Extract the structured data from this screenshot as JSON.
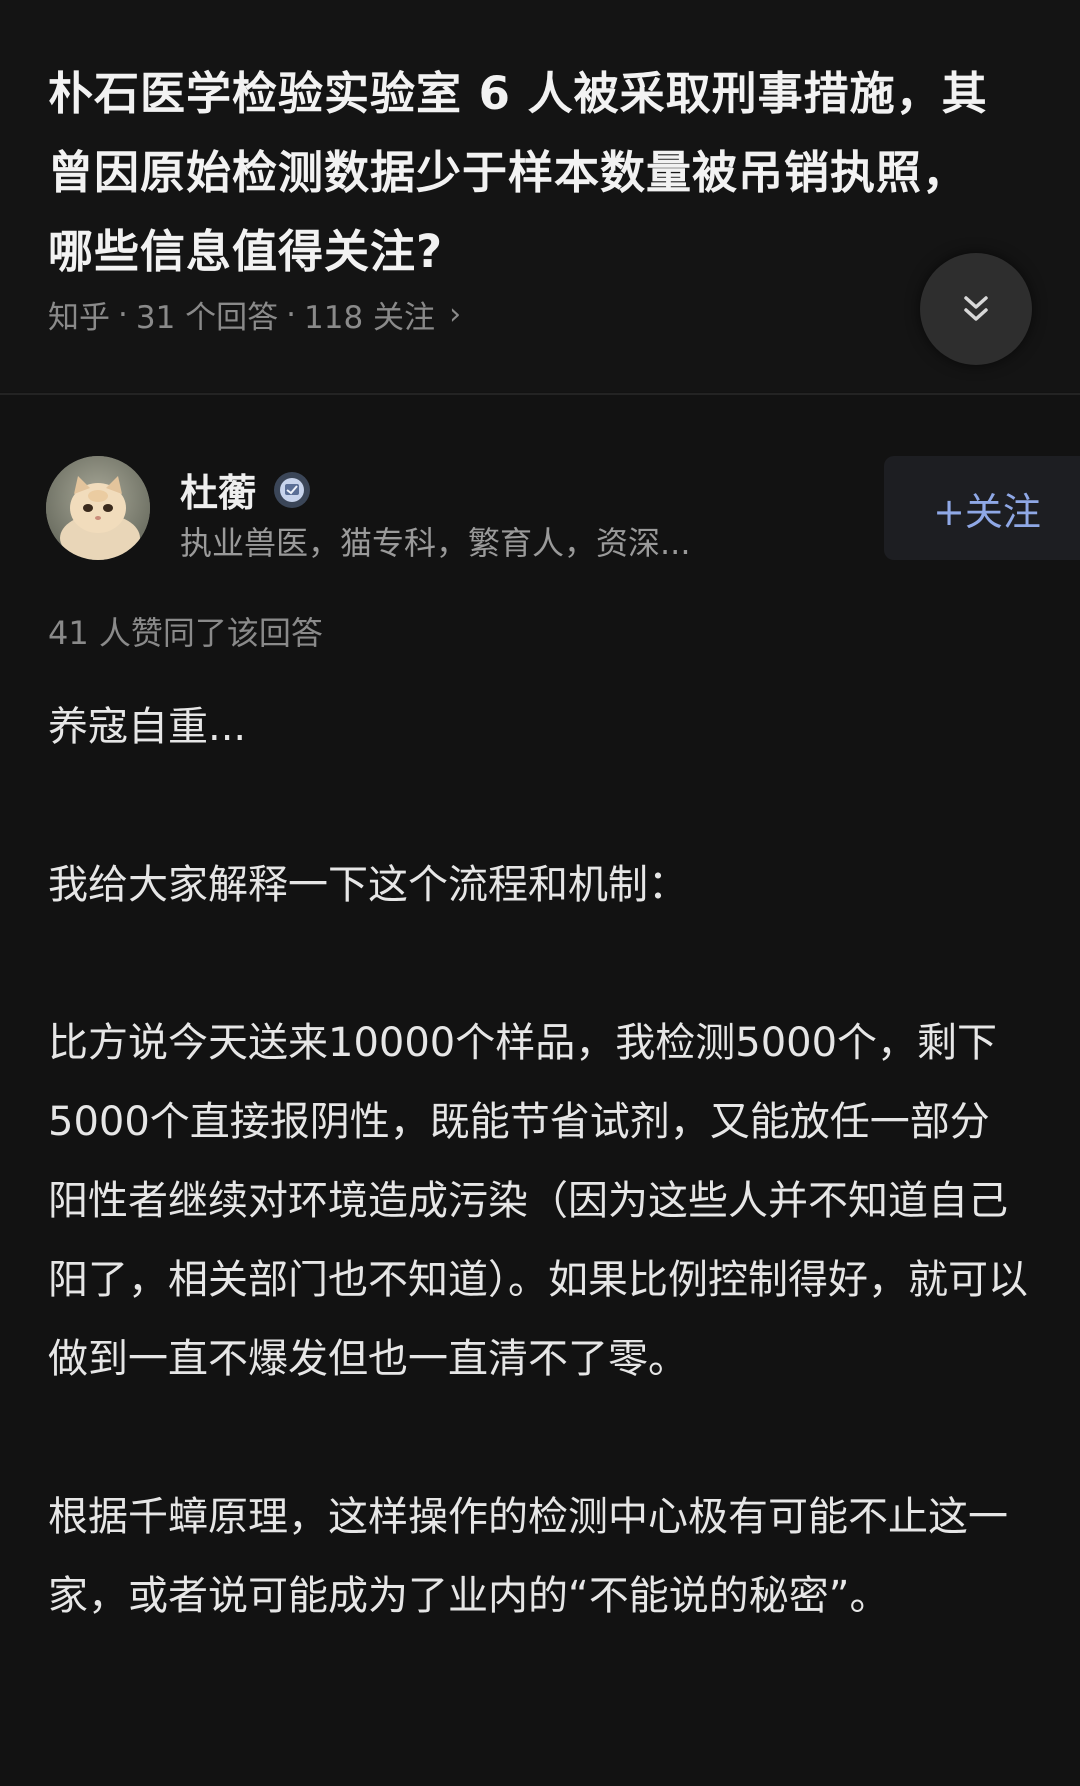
{
  "question": {
    "title": "朴石医学检验实验室 6 人被采取刑事措施，其曾因原始检测数据少于样本数量被吊销执照，哪些信息值得关注?",
    "source": "知乎",
    "separator": "·",
    "answers_count": "31 个回答",
    "followers_count": "118 关注",
    "chevron": "›"
  },
  "collapse_button": {
    "icon": "double-chevron-down"
  },
  "author": {
    "name": "杜蘅",
    "badge_icon": "verified-badge",
    "description": "执业兽医，猫专科，繁育人，资深...",
    "follow_label": "+关注"
  },
  "vote_info": "41 人赞同了该回答",
  "answer": {
    "paragraphs": [
      "养寇自重...",
      "我给大家解释一下这个流程和机制：",
      "比方说今天送来10000个样品，我检测5000个，剩下5000个直接报阴性，既能节省试剂，又能放任一部分阳性者继续对环境造成污染（因为这些人并不知道自己阳了，相关部门也不知道）。如果比例控制得好，就可以做到一直不爆发但也一直清不了零。",
      "根据千蟑原理，这样操作的检测中心极有可能不止这一家，或者说可能成为了业内的“不能说的秘密”。"
    ]
  },
  "colors": {
    "background": "#121212",
    "accent": "#8fa8e6",
    "muted_text": "#8a8a8a"
  }
}
